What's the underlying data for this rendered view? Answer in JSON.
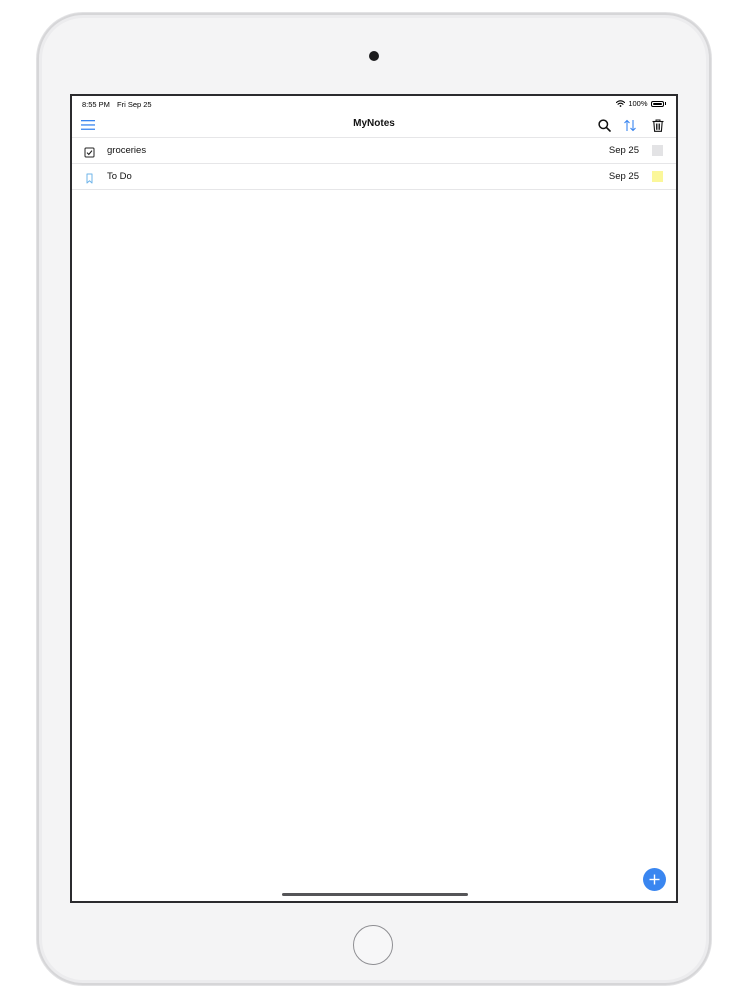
{
  "status_bar": {
    "time": "8:55 PM",
    "date": "Fri Sep 25",
    "battery_text": "100%",
    "battery_level": 1.0
  },
  "nav": {
    "title": "MyNotes",
    "icons": {
      "menu": "hamburger-menu-icon",
      "search": "search-icon",
      "sort": "sort-icon",
      "trash": "trash-icon"
    }
  },
  "notes": [
    {
      "title": "groceries",
      "date": "Sep 25",
      "icon": "checklist-icon",
      "color": "#e3e3e5"
    },
    {
      "title": "To Do",
      "date": "Sep 25",
      "icon": "bookmark-icon",
      "color": "#fbf79a"
    }
  ],
  "fab": {
    "icon": "plus-icon"
  },
  "colors": {
    "accent": "#3a86f0",
    "bookmark": "#6fb4ea"
  }
}
